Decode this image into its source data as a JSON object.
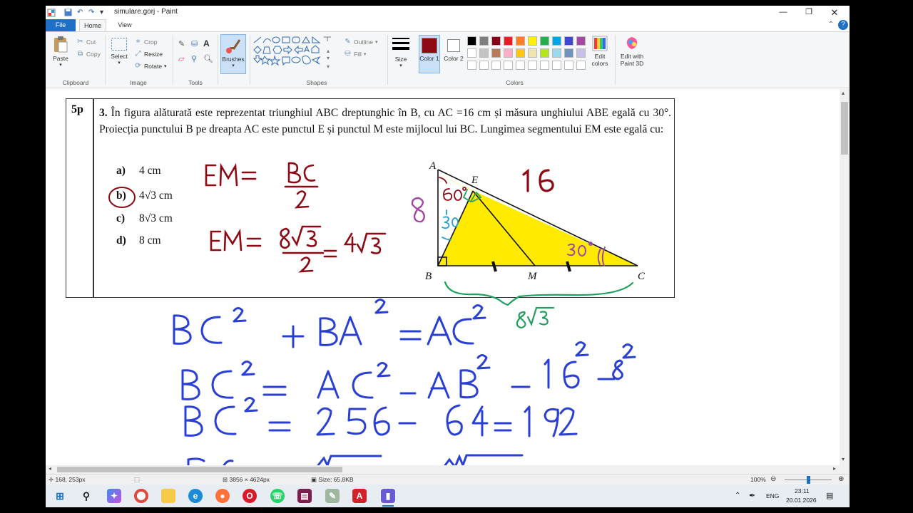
{
  "window": {
    "title": "simulare.gorj - Paint",
    "min_icon": "minimize-icon",
    "max_icon": "restore-icon",
    "close_icon": "close-icon"
  },
  "tabs": [
    {
      "label": "File"
    },
    {
      "label": "Home"
    },
    {
      "label": "View"
    }
  ],
  "ribbon": {
    "clipboard": {
      "paste": "Paste",
      "cut": "Cut",
      "copy": "Copy",
      "group": "Clipboard"
    },
    "image": {
      "select": "Select",
      "crop": "Crop",
      "resize": "Resize",
      "rotate": "Rotate",
      "group": "Image"
    },
    "tools": {
      "group": "Tools"
    },
    "brushes": {
      "label": "Brushes"
    },
    "shapes": {
      "outline": "Outline",
      "fill": "Fill",
      "group": "Shapes"
    },
    "size": {
      "label": "Size"
    },
    "colors": {
      "color1": "Color 1",
      "color2": "Color 2",
      "edit": "Edit colors",
      "group": "Colors",
      "color1_value": "#8b0a14",
      "color2_value": "#ffffff",
      "palette_row1": [
        "#000000",
        "#7f7f7f",
        "#880015",
        "#ed1c24",
        "#ff7f27",
        "#fff200",
        "#22b14c",
        "#00a2e8",
        "#3f48cc",
        "#a349a4"
      ],
      "palette_row2": [
        "#ffffff",
        "#c3c3c3",
        "#b97a57",
        "#ffaec9",
        "#ffc90e",
        "#efe4b0",
        "#b5e61d",
        "#99d9ea",
        "#7092be",
        "#c8bfe7"
      ]
    },
    "paint3d": {
      "label": "Edit with Paint 3D"
    }
  },
  "document": {
    "points": "5p",
    "problem_number": "3.",
    "problem_text": "În figura alăturată este reprezentat triunghiul ABC dreptunghic în B, cu AC =16 cm și măsura unghiului ABE egală cu 30°. Proiecția punctului B pe dreapta AC este punctul E și punctul M este mijlocul lui BC. Lungimea segmentului EM este egală cu:",
    "options": [
      {
        "letter": "a)",
        "value": "4 cm"
      },
      {
        "letter": "b)",
        "value": "4√3 cm"
      },
      {
        "letter": "c)",
        "value": "8√3 cm"
      },
      {
        "letter": "d)",
        "value": "8 cm"
      }
    ],
    "figure_points": {
      "A": "A",
      "B": "B",
      "C": "C",
      "E": "E",
      "M": "M"
    },
    "handwriting": {
      "em_bc": "EM = BC/2",
      "em_value": "EM = 8√3/2 = 4√3",
      "side_ab": "8",
      "side_ac": "16",
      "angle_a": "60°",
      "angle_abe": "30°",
      "angle_c": "30°",
      "bc_value": "8√3",
      "line1": "BC² + BA² = AC²",
      "line2": "BC² = AC² − AB² = 16² − 8²",
      "line3": "BC² = 256 − 64 = 192"
    }
  },
  "statusbar": {
    "cursor": "168, 253px",
    "canvas_size": "3856 × 4624px",
    "file_size": "Size: 65,8KB",
    "zoom": "100%"
  },
  "taskbar": {
    "lang": "ENG",
    "time": "23:11",
    "date": "20.01.2026"
  }
}
